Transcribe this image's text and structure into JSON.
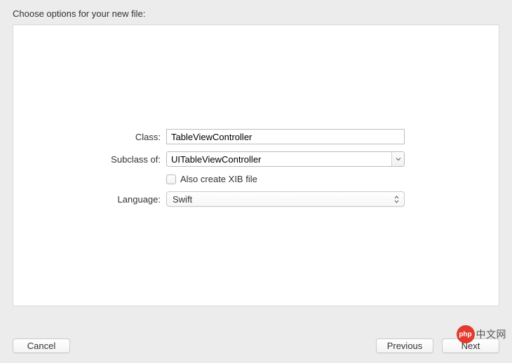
{
  "header": {
    "title": "Choose options for your new file:"
  },
  "form": {
    "class_label": "Class:",
    "class_value": "TableViewController",
    "subclass_label": "Subclass of:",
    "subclass_value": "UITableViewController",
    "xib_label": "Also create XIB file",
    "xib_checked": false,
    "language_label": "Language:",
    "language_value": "Swift"
  },
  "footer": {
    "cancel_label": "Cancel",
    "previous_label": "Previous",
    "next_label": "Next"
  },
  "watermark": {
    "badge": "php",
    "text": "中文网"
  }
}
